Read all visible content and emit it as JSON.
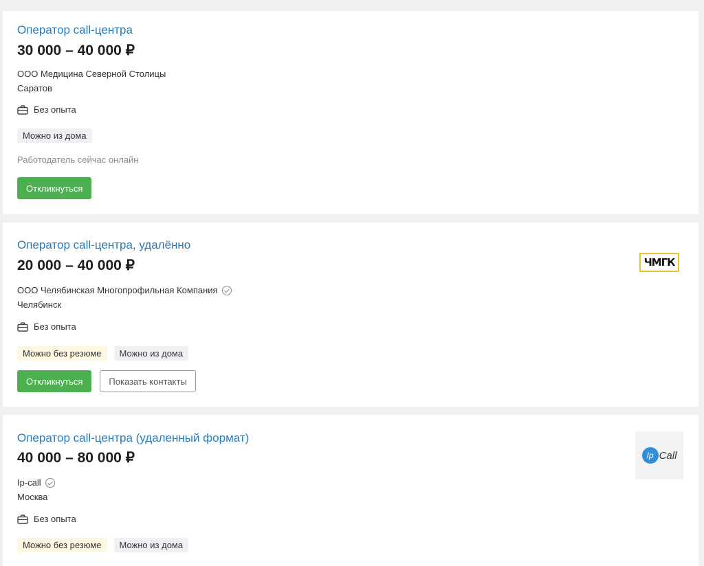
{
  "vacancies": [
    {
      "title": "Оператор call-центра",
      "salary": "30 000 – 40 000 ₽",
      "company": "ООО Медицина Северной Столицы",
      "city": "Саратов",
      "experience": "Без опыта",
      "tags": [
        "Можно из дома"
      ],
      "online_status": "Работодатель сейчас онлайн",
      "apply_label": "Откликнуться"
    },
    {
      "title": "Оператор call-центра, удалённо",
      "salary": "20 000 – 40 000 ₽",
      "company": "ООО Челябинская Многопрофильная Компания",
      "city": "Челябинск",
      "experience": "Без опыта",
      "tags": [
        "Можно без резюме",
        "Можно из дома"
      ],
      "apply_label": "Откликнуться",
      "contacts_label": "Показать контакты",
      "logo_text": "ЧМГК"
    },
    {
      "title": "Оператор call-центра (удаленный формат)",
      "salary": "40 000 – 80 000 ₽",
      "company": "Ip-call",
      "city": "Москва",
      "experience": "Без опыта",
      "tags": [
        "Можно без резюме",
        "Можно из дома"
      ],
      "logo_badge": "Ip",
      "logo_text": "Call"
    }
  ],
  "colors": {
    "link": "#2b7bb9",
    "apply_button": "#4caf50",
    "logo_border": "#e9c23c",
    "logo_ip": "#2f8fd8"
  }
}
